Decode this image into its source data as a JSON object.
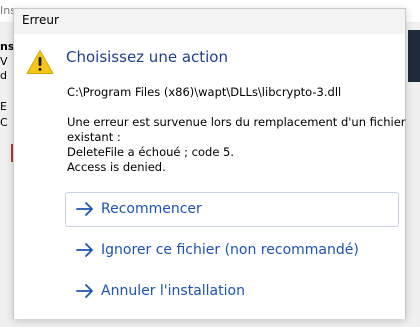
{
  "background": {
    "title_fragment": "Ins",
    "header_fragment": "ns",
    "fragments": [
      "V",
      "d",
      "E",
      "C"
    ]
  },
  "dialog": {
    "title": "Erreur",
    "heading": "Choisissez une action",
    "path": "C:\\Program Files (x86)\\wapt\\DLLs\\libcrypto-3.dll",
    "message_lines": [
      "Une erreur est survenue lors du remplacement d'un fichier",
      "existant :",
      "DeleteFile a échoué ; code 5.",
      "Access is denied."
    ],
    "commands": [
      {
        "label": "Recommencer"
      },
      {
        "label": "Ignorer ce fichier (non recommandé)"
      },
      {
        "label": "Annuler l'installation"
      }
    ]
  },
  "colors": {
    "accent": "#1c53b5",
    "heading": "#1c3f8f",
    "warning": "#f5c518"
  }
}
